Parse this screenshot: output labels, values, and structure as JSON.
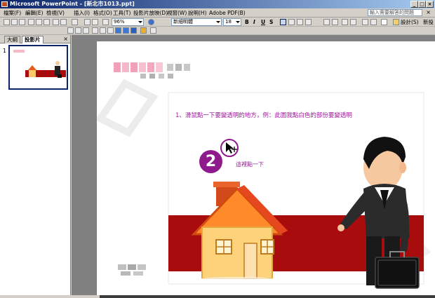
{
  "window": {
    "title": "Microsoft PowerPoint - [新北市1013.ppt]",
    "minimize": "_",
    "maximize": "□",
    "close": "×"
  },
  "menu": {
    "items": [
      "檔案(F)",
      "編輯(E)",
      "檢視(V)",
      "插入(I)",
      "格式(O)",
      "工具(T)",
      "投影片放映(D)",
      "視窗(W)",
      "說明(H)",
      "Adobe PDF(B)"
    ],
    "help_placeholder": "輸入需要解答的問題"
  },
  "toolbar": {
    "zoom": "96%",
    "font_name": "新細明體",
    "font_size": "18",
    "bold": "B",
    "italic": "I",
    "underline": "U",
    "shadow": "S",
    "design_label": "設計(S)",
    "new_slide_label": "新投"
  },
  "left_pane": {
    "tab_outline": "大綱",
    "tab_slides": "投影片",
    "close": "×",
    "slide_number": "1"
  },
  "slide": {
    "instruction": "1、滑鼠點一下要變透明的地方，例：此圖我點白色的部份要變透明",
    "step_number": "2",
    "click_hint": "這裡點一下"
  },
  "colors": {
    "accent_purple": "#a0169c",
    "banner_red": "#a80c0c",
    "title_bar": "#0a246a"
  }
}
